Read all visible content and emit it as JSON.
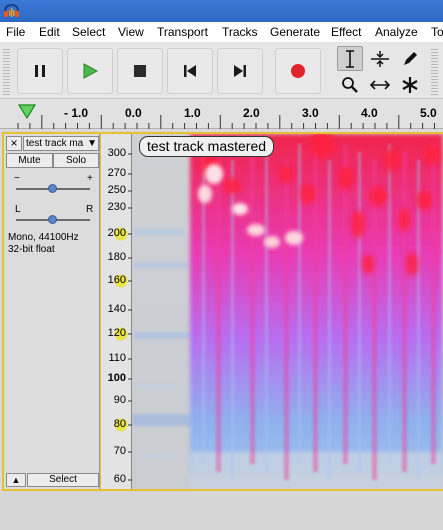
{
  "menu": [
    "File",
    "Edit",
    "Select",
    "View",
    "Transport",
    "Tracks",
    "Generate",
    "Effect",
    "Analyze",
    "To"
  ],
  "timeline": {
    "ticks": [
      "- 1.0",
      "0.0",
      "1.0",
      "2.0",
      "3.0",
      "4.0",
      "5.0"
    ]
  },
  "track": {
    "name": "test track ma",
    "label": "test track mastered",
    "mute_label": "Mute",
    "solo_label": "Solo",
    "gain_minus": "−",
    "gain_plus": "+",
    "pan_left": "L",
    "pan_right": "R",
    "info_line1": "Mono, 44100Hz",
    "info_line2": "32-bit float",
    "select_label": "Select"
  },
  "frequency_axis": [
    "300",
    "270",
    "250",
    "230",
    "200",
    "180",
    "160",
    "140",
    "120",
    "110",
    "100",
    "90",
    "80",
    "70",
    "60"
  ],
  "colors": {
    "accent_title": "#2f6ccb",
    "play_green": "#3aa23a",
    "record_red": "#e0242a",
    "selection_yellow": "#e6c232"
  }
}
